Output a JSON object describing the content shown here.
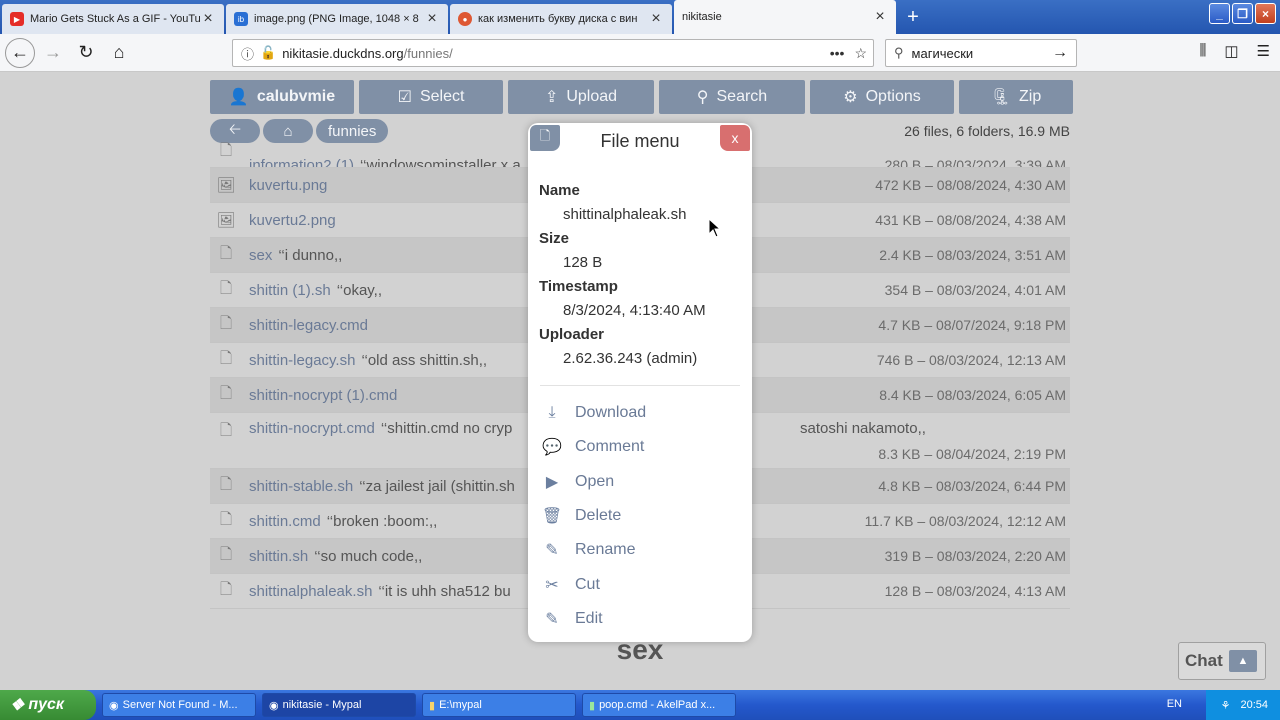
{
  "browser": {
    "tabs": [
      {
        "title": "Mario Gets Stuck As a GIF - YouTube",
        "icon": "youtube-icon",
        "color": "#e52d27"
      },
      {
        "title": "image.png (PNG Image, 1048 × 8",
        "icon": "ibb-icon",
        "color": "#2a6fd4"
      },
      {
        "title": "как изменить букву диска с вин",
        "icon": "duckduckgo-icon",
        "color": "#de5833"
      },
      {
        "title": "nikitasie",
        "icon": "",
        "color": ""
      }
    ],
    "url_host": "nikitasie.duckdns.org",
    "url_path": "/funnies/",
    "search_value": "магически"
  },
  "toolbar": {
    "user": "calubvmie",
    "select": "Select",
    "upload": "Upload",
    "search": "Search",
    "options": "Options",
    "zip": "Zip"
  },
  "breadcrumb": {
    "folder": "funnies"
  },
  "summary": "26 files, 6 folders, 16.9 MB",
  "files": [
    {
      "name": "information2 (1)",
      "comment": "‘‘windowsominstaller x a",
      "meta": "280 B – 08/03/2024, 3:39 AM",
      "type": "file"
    },
    {
      "name": "kuvertu.png",
      "comment": "",
      "meta": "472 KB – 08/08/2024, 4:30 AM",
      "type": "image"
    },
    {
      "name": "kuvertu2.png",
      "comment": "",
      "meta": "431 KB – 08/08/2024, 4:38 AM",
      "type": "image"
    },
    {
      "name": "sex",
      "comment": "‘‘i dunno,,",
      "meta": "2.4 KB – 08/03/2024, 3:51 AM",
      "type": "file"
    },
    {
      "name": "shittin (1).sh",
      "comment": "‘‘okay,,",
      "meta": "354 B – 08/03/2024, 4:01 AM",
      "type": "file"
    },
    {
      "name": "shittin-legacy.cmd",
      "comment": "",
      "meta": "4.7 KB – 08/07/2024, 9:18 PM",
      "type": "file"
    },
    {
      "name": "shittin-legacy.sh",
      "comment": "‘‘old ass shittin.sh,,",
      "meta": "746 B – 08/03/2024, 12:13 AM",
      "type": "file"
    },
    {
      "name": "shittin-nocrypt (1).cmd",
      "comment": "",
      "meta": "8.4 KB – 08/03/2024, 6:05 AM",
      "type": "file"
    },
    {
      "name": "shittin-nocrypt.cmd",
      "comment": "‘‘shittin.cmd no cryp",
      "comment_tail": "satoshi nakamoto,,",
      "meta": "8.3 KB – 08/04/2024, 2:19 PM",
      "type": "file"
    },
    {
      "name": "shittin-stable.sh",
      "comment": "‘‘za jailest jail (shittin.sh",
      "meta": "4.8 KB – 08/03/2024, 6:44 PM",
      "type": "file"
    },
    {
      "name": "shittin.cmd",
      "comment": "‘‘broken :boom:,,",
      "meta": "11.7 KB – 08/03/2024, 12:12 AM",
      "type": "file"
    },
    {
      "name": "shittin.sh",
      "comment": "‘‘so much code,,",
      "meta": "319 B – 08/03/2024, 2:20 AM",
      "type": "file"
    },
    {
      "name": "shittinalphaleak.sh",
      "comment": "‘‘it is uhh sha512 bu",
      "meta": "128 B – 08/03/2024, 4:13 AM",
      "type": "file"
    }
  ],
  "page_footer_title": "sex",
  "chat_label": "Chat",
  "modal": {
    "title": "File menu",
    "close": "x",
    "name_label": "Name",
    "name_value": "shittinalphaleak.sh",
    "size_label": "Size",
    "size_value": "128 B",
    "timestamp_label": "Timestamp",
    "timestamp_value": "8/3/2024, 4:13:40 AM",
    "uploader_label": "Uploader",
    "uploader_value": "2.62.36.243 (admin)",
    "actions": [
      "Download",
      "Comment",
      "Open",
      "Delete",
      "Rename",
      "Cut",
      "Edit"
    ]
  },
  "taskbar": {
    "start": "пуск",
    "tasks": [
      "Server Not Found - M...",
      "nikitasie - Mypal",
      "E:\\mypal",
      "poop.cmd - AkelPad x..."
    ],
    "lang": "EN",
    "clock": "20:54"
  }
}
